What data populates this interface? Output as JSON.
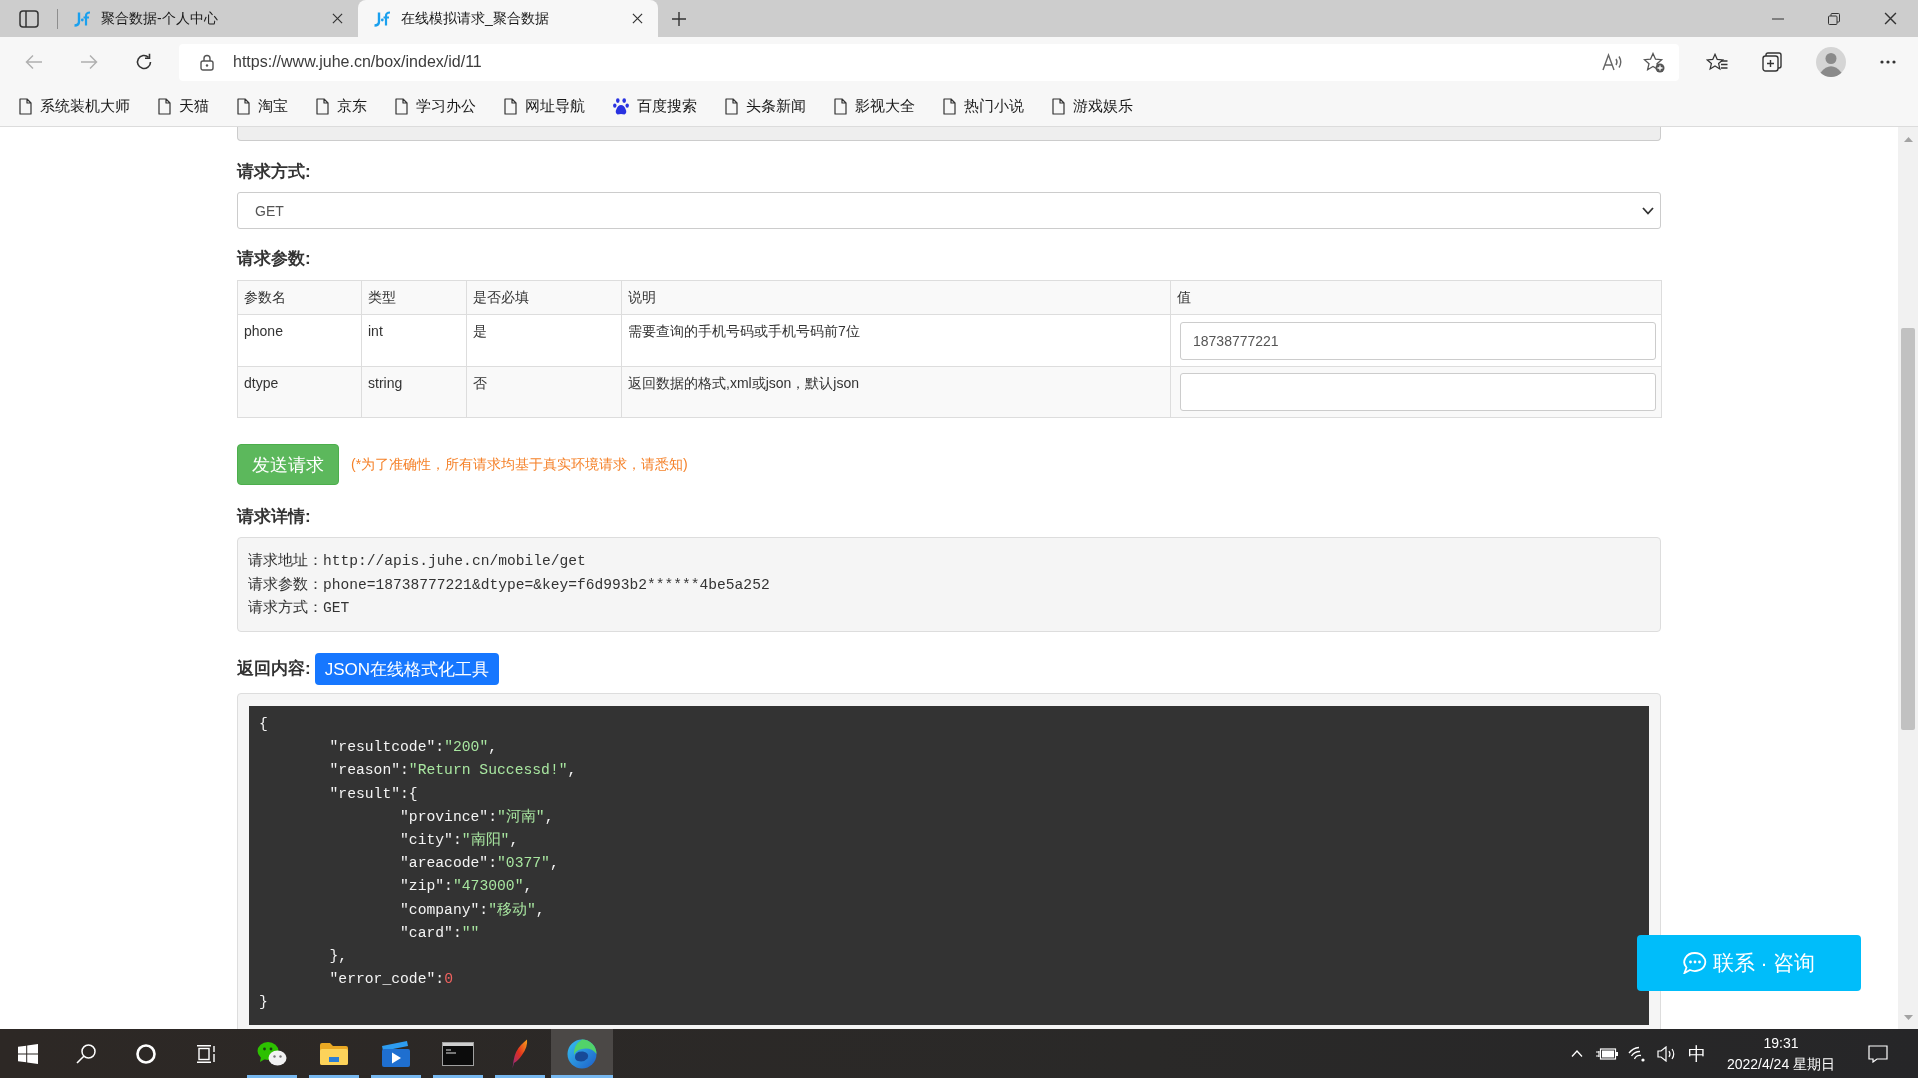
{
  "browser": {
    "tabs": [
      {
        "title": "聚合数据-个人中心",
        "selected": false
      },
      {
        "title": "在线模拟请求_聚合数据",
        "selected": true
      }
    ],
    "url": "https://www.juhe.cn/box/index/id/11",
    "bookmarks": [
      {
        "label": "系统装机大师",
        "kind": "page"
      },
      {
        "label": "天猫",
        "kind": "page"
      },
      {
        "label": "淘宝",
        "kind": "page"
      },
      {
        "label": "京东",
        "kind": "page"
      },
      {
        "label": "学习办公",
        "kind": "page"
      },
      {
        "label": "网址导航",
        "kind": "page"
      },
      {
        "label": "百度搜索",
        "kind": "paw"
      },
      {
        "label": "头条新闻",
        "kind": "page"
      },
      {
        "label": "影视大全",
        "kind": "page"
      },
      {
        "label": "热门小说",
        "kind": "page"
      },
      {
        "label": "游戏娱乐",
        "kind": "page"
      }
    ]
  },
  "request_form": {
    "method_label": "请求方式:",
    "method": "GET",
    "params_label": "请求参数:",
    "columns": [
      "参数名",
      "类型",
      "是否必填",
      "说明",
      "值"
    ],
    "rows": [
      {
        "name": "phone",
        "type": "int",
        "required": "是",
        "description": "需要查询的手机号码或手机号码前7位",
        "value": "18738777221"
      },
      {
        "name": "dtype",
        "type": "string",
        "required": "否",
        "description": "返回数据的格式,xml或json，默认json"
      }
    ],
    "send_button": "发送请求",
    "notice": "(*为了准确性，所有请求均基于真实环境请求，请悉知)"
  },
  "request_details": {
    "label": "请求详情:",
    "lines": [
      "请求地址：http://apis.juhe.cn/mobile/get",
      "请求参数：phone=18738777221&dtype=&key=f6d993b2******4be5a252",
      "请求方式：GET"
    ]
  },
  "response": {
    "label": "返回内容:",
    "format_button": "JSON在线格式化工具",
    "code_lines": [
      {
        "parts": [
          {
            "text": "{",
            "kind": "punct"
          }
        ]
      },
      {
        "parts": [
          {
            "text": "\t\"resultcode\"",
            "kind": "key"
          },
          {
            "text": ":",
            "kind": "punct"
          },
          {
            "text": "\"200\"",
            "kind": "string"
          },
          {
            "text": ",",
            "kind": "punct"
          }
        ]
      },
      {
        "parts": [
          {
            "text": "\t\"reason\"",
            "kind": "key"
          },
          {
            "text": ":",
            "kind": "punct"
          },
          {
            "text": "\"Return Successd!\"",
            "kind": "string"
          },
          {
            "text": ",",
            "kind": "punct"
          }
        ]
      },
      {
        "parts": [
          {
            "text": "\t\"result\"",
            "kind": "key"
          },
          {
            "text": ":{",
            "kind": "punct"
          }
        ]
      },
      {
        "parts": [
          {
            "text": "\t\t\"province\"",
            "kind": "key"
          },
          {
            "text": ":",
            "kind": "punct"
          },
          {
            "text": "\"河南\"",
            "kind": "string"
          },
          {
            "text": ",",
            "kind": "punct"
          }
        ]
      },
      {
        "parts": [
          {
            "text": "\t\t\"city\"",
            "kind": "key"
          },
          {
            "text": ":",
            "kind": "punct"
          },
          {
            "text": "\"南阳\"",
            "kind": "string"
          },
          {
            "text": ",",
            "kind": "punct"
          }
        ]
      },
      {
        "parts": [
          {
            "text": "\t\t\"areacode\"",
            "kind": "key"
          },
          {
            "text": ":",
            "kind": "punct"
          },
          {
            "text": "\"0377\"",
            "kind": "string"
          },
          {
            "text": ",",
            "kind": "punct"
          }
        ]
      },
      {
        "parts": [
          {
            "text": "\t\t\"zip\"",
            "kind": "key"
          },
          {
            "text": ":",
            "kind": "punct"
          },
          {
            "text": "\"473000\"",
            "kind": "string"
          },
          {
            "text": ",",
            "kind": "punct"
          }
        ]
      },
      {
        "parts": [
          {
            "text": "\t\t\"company\"",
            "kind": "key"
          },
          {
            "text": ":",
            "kind": "punct"
          },
          {
            "text": "\"移动\"",
            "kind": "string"
          },
          {
            "text": ",",
            "kind": "punct"
          }
        ]
      },
      {
        "parts": [
          {
            "text": "\t\t\"card\"",
            "kind": "key"
          },
          {
            "text": ":",
            "kind": "punct"
          },
          {
            "text": "\"\"",
            "kind": "string"
          }
        ]
      },
      {
        "parts": [
          {
            "text": "\t},",
            "kind": "punct"
          }
        ]
      },
      {
        "parts": [
          {
            "text": "\t\"error_code\"",
            "kind": "key"
          },
          {
            "text": ":",
            "kind": "punct"
          },
          {
            "text": "0",
            "kind": "number"
          }
        ]
      },
      {
        "parts": [
          {
            "text": "}",
            "kind": "punct"
          }
        ]
      }
    ]
  },
  "contact_button": "联系 · 咨询",
  "taskbar": {
    "apps": [
      {
        "kind": "chat",
        "running": true,
        "selected": false
      },
      {
        "kind": "folder",
        "running": true,
        "selected": false
      },
      {
        "kind": "video",
        "running": true,
        "selected": false
      },
      {
        "kind": "terminal",
        "running": true,
        "selected": false
      },
      {
        "kind": "feather",
        "running": true,
        "selected": false
      },
      {
        "kind": "browser",
        "running": true,
        "selected": true
      }
    ],
    "ime": "中",
    "time": "19:31",
    "date": "2022/4/24 星期日"
  }
}
